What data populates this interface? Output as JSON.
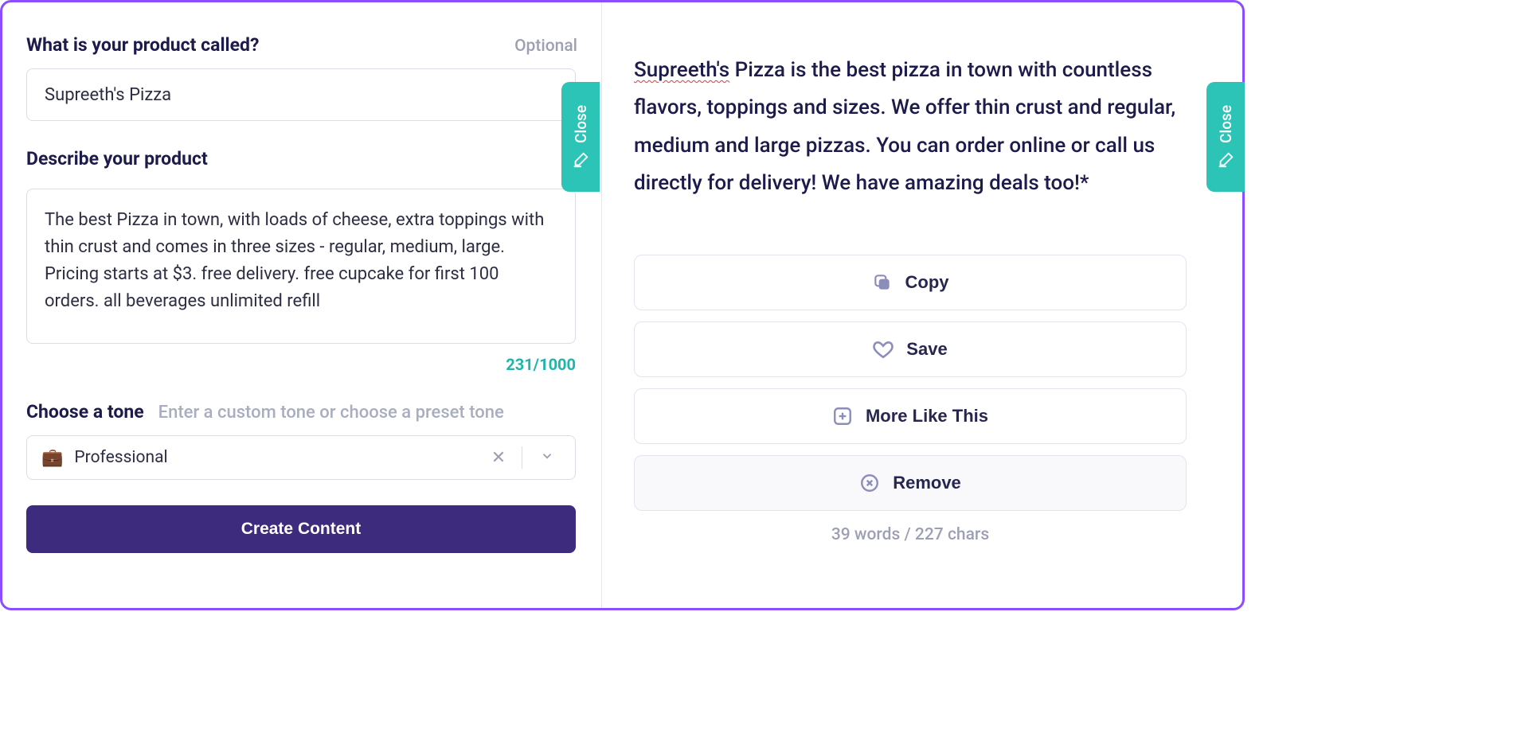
{
  "close_label": "Close",
  "left": {
    "product_name": {
      "label": "What is your product called?",
      "optional": "Optional",
      "value": "Supreeth's Pizza"
    },
    "describe": {
      "label": "Describe your product",
      "value": "The best Pizza in town, with loads of cheese, extra toppings with thin crust and comes in three sizes - regular, medium, large. Pricing starts at $3. free delivery. free cupcake for first 100 orders. all beverages unlimited refill",
      "counter": "231/1000"
    },
    "tone": {
      "label": "Choose a tone",
      "hint": "Enter a custom tone or choose a preset tone",
      "icon": "💼",
      "value": "Professional"
    },
    "create_button": "Create Content"
  },
  "right": {
    "generated": {
      "spellmark_word": "Supreeth's",
      "rest": " Pizza is the best pizza in town with countless flavors, toppings and sizes. We offer thin crust and regular, medium and large pizzas. You can order online or call us directly for delivery! We have amazing deals too!*"
    },
    "actions": {
      "copy": "Copy",
      "save": "Save",
      "more": "More Like This",
      "remove": "Remove"
    },
    "stats": "39 words / 227 chars"
  }
}
